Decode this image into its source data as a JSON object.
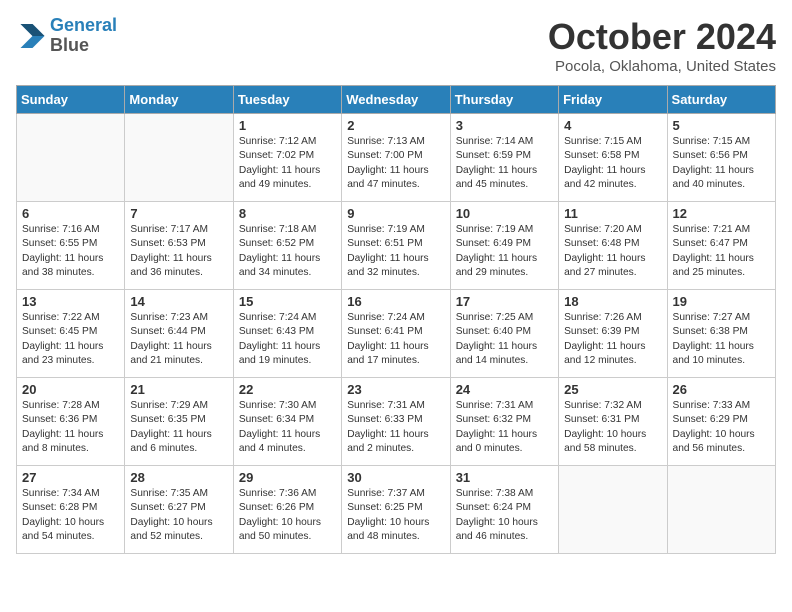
{
  "header": {
    "logo_line1": "General",
    "logo_line2": "Blue",
    "month": "October 2024",
    "location": "Pocola, Oklahoma, United States"
  },
  "weekdays": [
    "Sunday",
    "Monday",
    "Tuesday",
    "Wednesday",
    "Thursday",
    "Friday",
    "Saturday"
  ],
  "weeks": [
    [
      {
        "day": "",
        "sunrise": "",
        "sunset": "",
        "daylight": ""
      },
      {
        "day": "",
        "sunrise": "",
        "sunset": "",
        "daylight": ""
      },
      {
        "day": "1",
        "sunrise": "Sunrise: 7:12 AM",
        "sunset": "Sunset: 7:02 PM",
        "daylight": "Daylight: 11 hours and 49 minutes."
      },
      {
        "day": "2",
        "sunrise": "Sunrise: 7:13 AM",
        "sunset": "Sunset: 7:00 PM",
        "daylight": "Daylight: 11 hours and 47 minutes."
      },
      {
        "day": "3",
        "sunrise": "Sunrise: 7:14 AM",
        "sunset": "Sunset: 6:59 PM",
        "daylight": "Daylight: 11 hours and 45 minutes."
      },
      {
        "day": "4",
        "sunrise": "Sunrise: 7:15 AM",
        "sunset": "Sunset: 6:58 PM",
        "daylight": "Daylight: 11 hours and 42 minutes."
      },
      {
        "day": "5",
        "sunrise": "Sunrise: 7:15 AM",
        "sunset": "Sunset: 6:56 PM",
        "daylight": "Daylight: 11 hours and 40 minutes."
      }
    ],
    [
      {
        "day": "6",
        "sunrise": "Sunrise: 7:16 AM",
        "sunset": "Sunset: 6:55 PM",
        "daylight": "Daylight: 11 hours and 38 minutes."
      },
      {
        "day": "7",
        "sunrise": "Sunrise: 7:17 AM",
        "sunset": "Sunset: 6:53 PM",
        "daylight": "Daylight: 11 hours and 36 minutes."
      },
      {
        "day": "8",
        "sunrise": "Sunrise: 7:18 AM",
        "sunset": "Sunset: 6:52 PM",
        "daylight": "Daylight: 11 hours and 34 minutes."
      },
      {
        "day": "9",
        "sunrise": "Sunrise: 7:19 AM",
        "sunset": "Sunset: 6:51 PM",
        "daylight": "Daylight: 11 hours and 32 minutes."
      },
      {
        "day": "10",
        "sunrise": "Sunrise: 7:19 AM",
        "sunset": "Sunset: 6:49 PM",
        "daylight": "Daylight: 11 hours and 29 minutes."
      },
      {
        "day": "11",
        "sunrise": "Sunrise: 7:20 AM",
        "sunset": "Sunset: 6:48 PM",
        "daylight": "Daylight: 11 hours and 27 minutes."
      },
      {
        "day": "12",
        "sunrise": "Sunrise: 7:21 AM",
        "sunset": "Sunset: 6:47 PM",
        "daylight": "Daylight: 11 hours and 25 minutes."
      }
    ],
    [
      {
        "day": "13",
        "sunrise": "Sunrise: 7:22 AM",
        "sunset": "Sunset: 6:45 PM",
        "daylight": "Daylight: 11 hours and 23 minutes."
      },
      {
        "day": "14",
        "sunrise": "Sunrise: 7:23 AM",
        "sunset": "Sunset: 6:44 PM",
        "daylight": "Daylight: 11 hours and 21 minutes."
      },
      {
        "day": "15",
        "sunrise": "Sunrise: 7:24 AM",
        "sunset": "Sunset: 6:43 PM",
        "daylight": "Daylight: 11 hours and 19 minutes."
      },
      {
        "day": "16",
        "sunrise": "Sunrise: 7:24 AM",
        "sunset": "Sunset: 6:41 PM",
        "daylight": "Daylight: 11 hours and 17 minutes."
      },
      {
        "day": "17",
        "sunrise": "Sunrise: 7:25 AM",
        "sunset": "Sunset: 6:40 PM",
        "daylight": "Daylight: 11 hours and 14 minutes."
      },
      {
        "day": "18",
        "sunrise": "Sunrise: 7:26 AM",
        "sunset": "Sunset: 6:39 PM",
        "daylight": "Daylight: 11 hours and 12 minutes."
      },
      {
        "day": "19",
        "sunrise": "Sunrise: 7:27 AM",
        "sunset": "Sunset: 6:38 PM",
        "daylight": "Daylight: 11 hours and 10 minutes."
      }
    ],
    [
      {
        "day": "20",
        "sunrise": "Sunrise: 7:28 AM",
        "sunset": "Sunset: 6:36 PM",
        "daylight": "Daylight: 11 hours and 8 minutes."
      },
      {
        "day": "21",
        "sunrise": "Sunrise: 7:29 AM",
        "sunset": "Sunset: 6:35 PM",
        "daylight": "Daylight: 11 hours and 6 minutes."
      },
      {
        "day": "22",
        "sunrise": "Sunrise: 7:30 AM",
        "sunset": "Sunset: 6:34 PM",
        "daylight": "Daylight: 11 hours and 4 minutes."
      },
      {
        "day": "23",
        "sunrise": "Sunrise: 7:31 AM",
        "sunset": "Sunset: 6:33 PM",
        "daylight": "Daylight: 11 hours and 2 minutes."
      },
      {
        "day": "24",
        "sunrise": "Sunrise: 7:31 AM",
        "sunset": "Sunset: 6:32 PM",
        "daylight": "Daylight: 11 hours and 0 minutes."
      },
      {
        "day": "25",
        "sunrise": "Sunrise: 7:32 AM",
        "sunset": "Sunset: 6:31 PM",
        "daylight": "Daylight: 10 hours and 58 minutes."
      },
      {
        "day": "26",
        "sunrise": "Sunrise: 7:33 AM",
        "sunset": "Sunset: 6:29 PM",
        "daylight": "Daylight: 10 hours and 56 minutes."
      }
    ],
    [
      {
        "day": "27",
        "sunrise": "Sunrise: 7:34 AM",
        "sunset": "Sunset: 6:28 PM",
        "daylight": "Daylight: 10 hours and 54 minutes."
      },
      {
        "day": "28",
        "sunrise": "Sunrise: 7:35 AM",
        "sunset": "Sunset: 6:27 PM",
        "daylight": "Daylight: 10 hours and 52 minutes."
      },
      {
        "day": "29",
        "sunrise": "Sunrise: 7:36 AM",
        "sunset": "Sunset: 6:26 PM",
        "daylight": "Daylight: 10 hours and 50 minutes."
      },
      {
        "day": "30",
        "sunrise": "Sunrise: 7:37 AM",
        "sunset": "Sunset: 6:25 PM",
        "daylight": "Daylight: 10 hours and 48 minutes."
      },
      {
        "day": "31",
        "sunrise": "Sunrise: 7:38 AM",
        "sunset": "Sunset: 6:24 PM",
        "daylight": "Daylight: 10 hours and 46 minutes."
      },
      {
        "day": "",
        "sunrise": "",
        "sunset": "",
        "daylight": ""
      },
      {
        "day": "",
        "sunrise": "",
        "sunset": "",
        "daylight": ""
      }
    ]
  ]
}
